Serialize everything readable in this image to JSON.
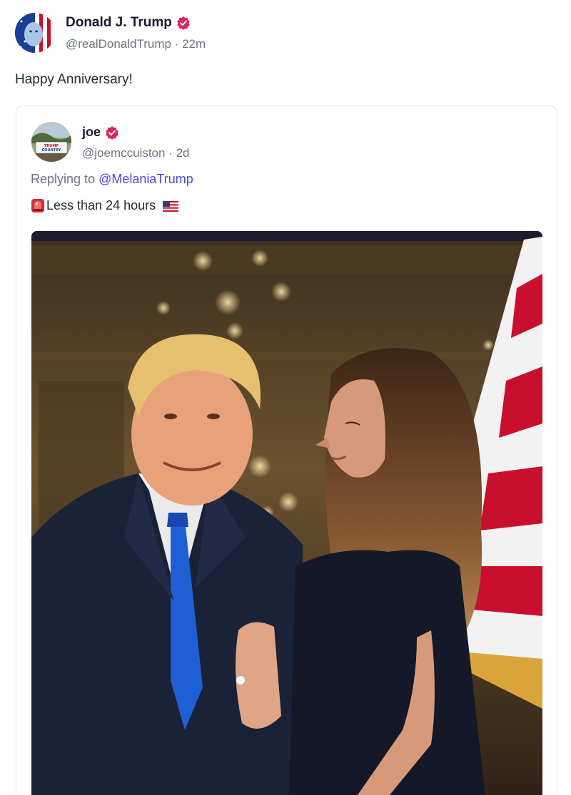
{
  "post": {
    "author": {
      "name": "Donald J. Trump",
      "handle": "@realDonaldTrump",
      "time": "22m",
      "separator": " · ",
      "verified": true
    },
    "text": "Happy Anniversary!"
  },
  "quote": {
    "author": {
      "name": "joe",
      "handle": "@joemccuiston",
      "time": "2d",
      "separator": " · ",
      "verified": true,
      "avatar_sign_text": "TRUMP COUNTRY"
    },
    "replying_prefix": "Replying to ",
    "replying_to": "@MelaniaTrump",
    "text": "Less than 24 hours",
    "emoji_icons": [
      "siren-icon",
      "us-flag-icon"
    ]
  },
  "colors": {
    "verified_badge": "#e0245e",
    "mention": "#4f46e5",
    "handle_gray": "#6b7280",
    "card_border": "#e5e7eb"
  }
}
